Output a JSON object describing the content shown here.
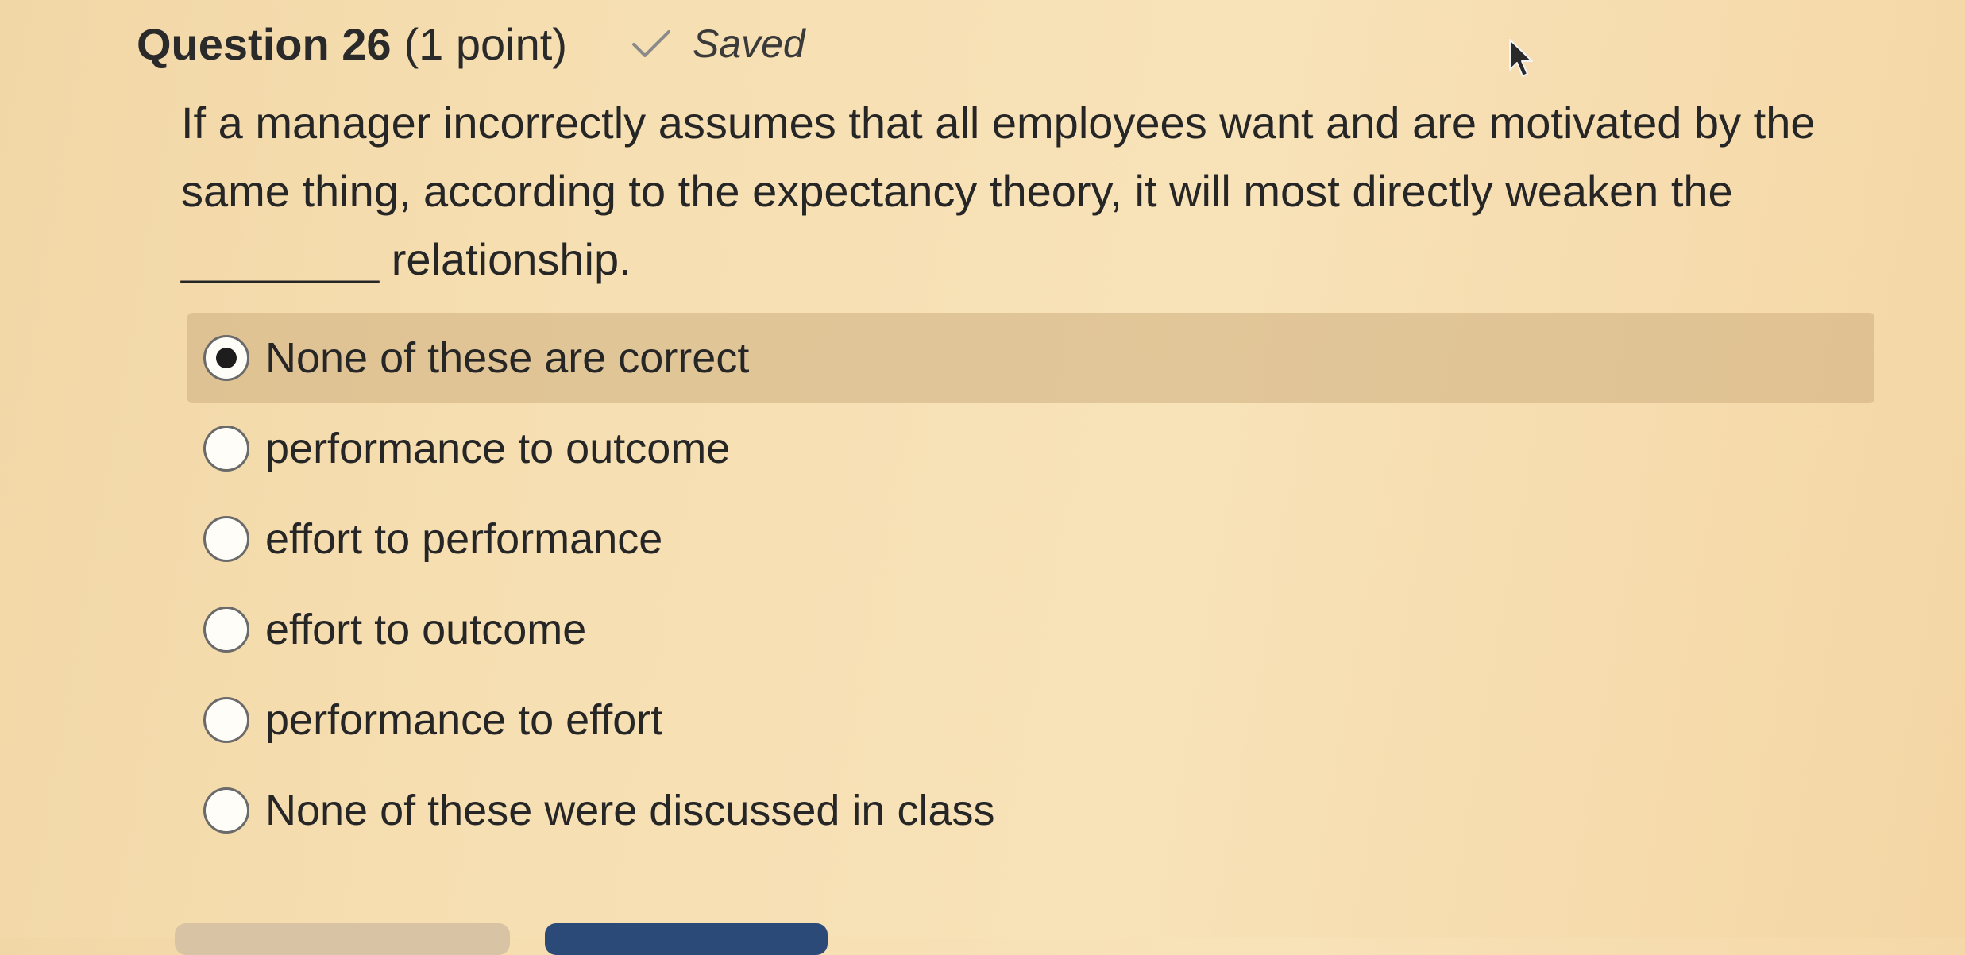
{
  "header": {
    "title": "Question 26",
    "points": "(1 point)",
    "status": "Saved",
    "status_icon": "check-icon"
  },
  "question": {
    "text": "If a manager incorrectly assumes that all employees want and are motivated by the same thing, according to the expectancy theory, it will most directly weaken the ________ relationship."
  },
  "options": [
    {
      "label": "None of these are correct",
      "selected": true
    },
    {
      "label": "performance to outcome",
      "selected": false
    },
    {
      "label": "effort to performance",
      "selected": false
    },
    {
      "label": "effort to outcome",
      "selected": false
    },
    {
      "label": "performance to effort",
      "selected": false
    },
    {
      "label": "None of these were discussed in class",
      "selected": false
    }
  ],
  "colors": {
    "background": "#f6dfb2",
    "selected_highlight": "#d9bf94",
    "primary_button": "#2c4a78"
  }
}
